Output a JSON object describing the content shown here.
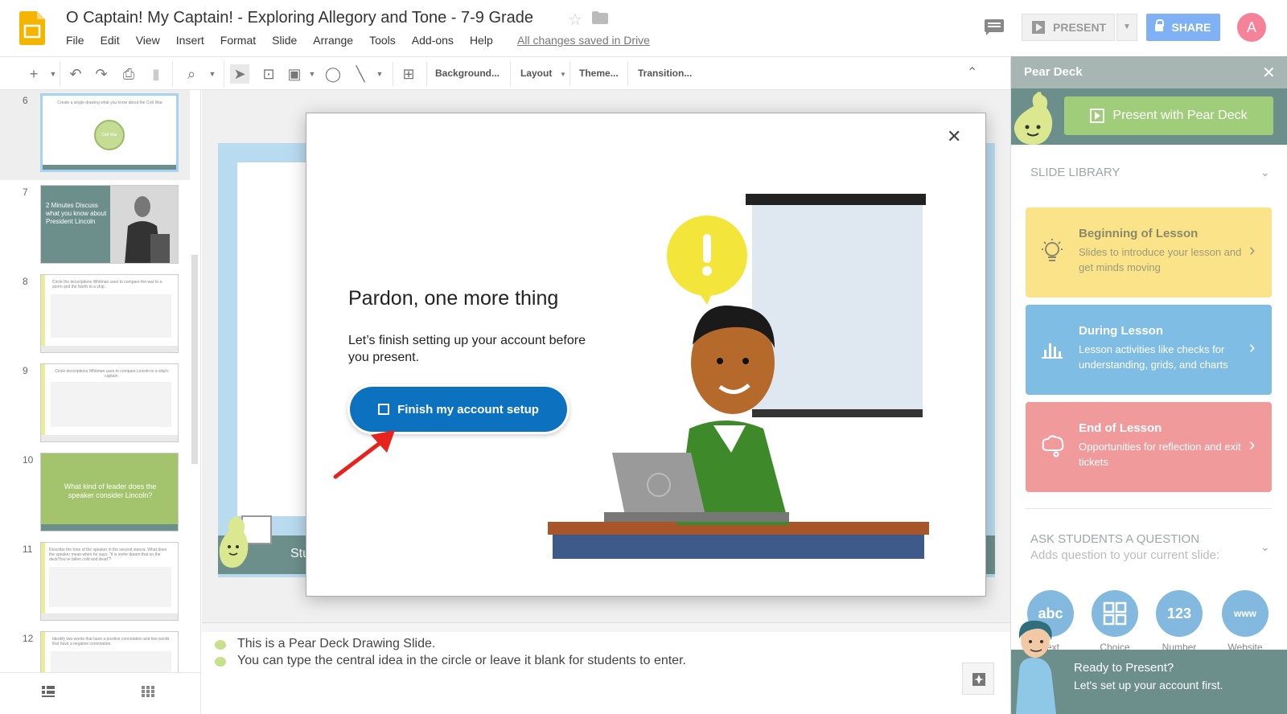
{
  "header": {
    "title": "O Captain! My Captain! - Exploring Allegory and Tone - 7-9 Grade",
    "menu": [
      "File",
      "Edit",
      "View",
      "Insert",
      "Format",
      "Slide",
      "Arrange",
      "Tools",
      "Add-ons",
      "Help"
    ],
    "saved_status": "All changes saved in Drive",
    "present_label": "PRESENT",
    "share_label": "SHARE",
    "avatar_initial": "A"
  },
  "toolbar": {
    "background": "Background...",
    "layout": "Layout",
    "theme": "Theme...",
    "transition": "Transition..."
  },
  "filmstrip": {
    "slides": [
      {
        "num": "6",
        "text": "Create a single drawing what you know about the Civil War.",
        "center": "Civil War"
      },
      {
        "num": "7",
        "text": "2 Minutes Discuss what you know about President Lincoln"
      },
      {
        "num": "8",
        "text": "Circle the descriptions Whitman uses to compare the war to a storm and the North to a ship."
      },
      {
        "num": "9",
        "text": "Circle descriptions Whitman uses to compare Lincoln to a ship's captain."
      },
      {
        "num": "10",
        "text": "What kind of leader does the speaker consider Lincoln?"
      },
      {
        "num": "11",
        "text": "Describe the tone of the speaker in the second stanza. What does the speaker mean when he says, \"It is some dream that on the deck/You've fallen cold and dead\"?"
      },
      {
        "num": "12",
        "text": "Identify two words that have a positive connotation and two words that have a negative connotation."
      }
    ]
  },
  "canvas": {
    "slide_footer": "Stu"
  },
  "notes": {
    "lines": [
      "This is a Pear Deck Drawing Slide.",
      "You can type the central idea in the circle or leave it blank for students to enter."
    ]
  },
  "modal": {
    "heading": "Pardon, one more thing",
    "body": "Let’s finish setting up your account before you present.",
    "button": "Finish my account setup"
  },
  "peardeck": {
    "title": "Pear Deck",
    "present_button": "Present with Pear Deck",
    "slide_library": "SLIDE LIBRARY",
    "cards": [
      {
        "title": "Beginning of Lesson",
        "desc": "Slides to introduce your lesson and get minds moving",
        "bg": "#fbe38a",
        "fg": "#8a8a6a"
      },
      {
        "title": "During Lesson",
        "desc": "Lesson activities like checks for understanding, grids, and charts",
        "bg": "#7fbde5",
        "fg": "#ffffff"
      },
      {
        "title": "End of Lesson",
        "desc": "Opportunities for reflection and exit tickets",
        "bg": "#f19a9c",
        "fg": "#ffffff"
      }
    ],
    "ask_title": "ASK STUDENTS A QUESTION",
    "ask_sub": "Adds question to your current slide:",
    "question_types": [
      {
        "icon": "abc",
        "label": "Text"
      },
      {
        "icon": "grid",
        "label": "Choice"
      },
      {
        "icon": "123",
        "label": "Number"
      },
      {
        "icon": "www",
        "label": "Website"
      }
    ],
    "ready_title": "Ready to Present?",
    "ready_sub": "Let's set up your account first."
  },
  "colors": {
    "accent_blue": "#0c71be",
    "share_blue": "#7fb1f4",
    "peardeck_green": "#6d8f8c",
    "pear_lime": "#9fcd7a"
  }
}
